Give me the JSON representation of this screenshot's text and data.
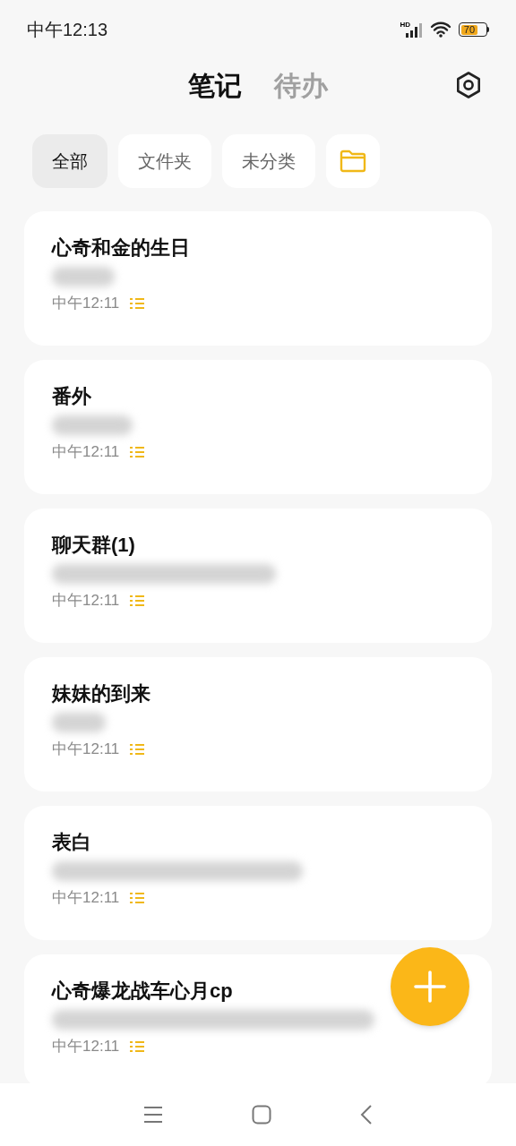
{
  "status_bar": {
    "time": "中午12:13",
    "network": "HD",
    "battery": "70"
  },
  "tabs": [
    {
      "label": "笔记",
      "selected": true
    },
    {
      "label": "待办",
      "selected": false
    }
  ],
  "filters": [
    {
      "label": "全部",
      "selected": true
    },
    {
      "label": "文件夹",
      "selected": false
    },
    {
      "label": "未分类",
      "selected": false
    }
  ],
  "notes": [
    {
      "title": "心奇和金的生日",
      "time": "中午12:11"
    },
    {
      "title": "番外",
      "time": "中午12:11"
    },
    {
      "title": "聊天群(1)",
      "time": "中午12:11"
    },
    {
      "title": "妹妹的到来",
      "time": "中午12:11"
    },
    {
      "title": "表白",
      "time": "中午12:11"
    },
    {
      "title": "心奇爆龙战车心月cp",
      "time": "中午12:11"
    }
  ]
}
